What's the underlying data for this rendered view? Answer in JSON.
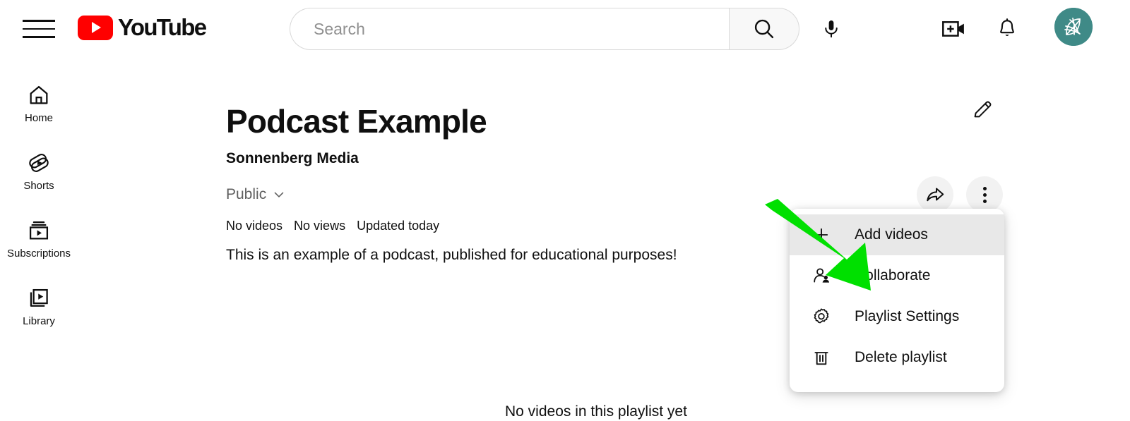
{
  "header": {
    "menu_button": "hamburger-menu",
    "logo_text": "YouTube",
    "search": {
      "placeholder": "Search",
      "value": "",
      "search_button": "search-icon",
      "mic_button": "microphone-icon"
    },
    "create_button": "create-video-icon",
    "notifications_button": "notifications-bell-icon",
    "avatar": "account-avatar",
    "avatar_color": "#3f8a87"
  },
  "sidebar": {
    "items": [
      {
        "label": "Home",
        "icon": "home-icon"
      },
      {
        "label": "Shorts",
        "icon": "shorts-icon"
      },
      {
        "label": "Subscriptions",
        "icon": "subscriptions-icon"
      },
      {
        "label": "Library",
        "icon": "library-icon"
      }
    ]
  },
  "playlist": {
    "title": "Podcast Example",
    "channel": "Sonnenberg Media",
    "privacy": "Public",
    "privacy_chevron": "chevron-down-icon",
    "stats": [
      "No videos",
      "No views",
      "Updated today"
    ],
    "description": "This is an example of a podcast, published for educational purposes!",
    "empty_state": "No videos in this playlist yet",
    "edit_icon": "pencil-edit-icon",
    "share_icon": "share-arrow-icon",
    "more_icon": "more-vertical-icon"
  },
  "menu": {
    "items": [
      {
        "label": "Add videos",
        "icon": "plus-icon",
        "active": true
      },
      {
        "label": "Collaborate",
        "icon": "person-add-icon",
        "active": false
      },
      {
        "label": "Playlist Settings",
        "icon": "gear-icon",
        "active": false
      },
      {
        "label": "Delete playlist",
        "icon": "trash-icon",
        "active": false
      }
    ],
    "highlight_color": "#e8e8e8"
  },
  "annotation": {
    "arrow_color": "#00e000",
    "arrow_name": "green-pointer-arrow"
  }
}
